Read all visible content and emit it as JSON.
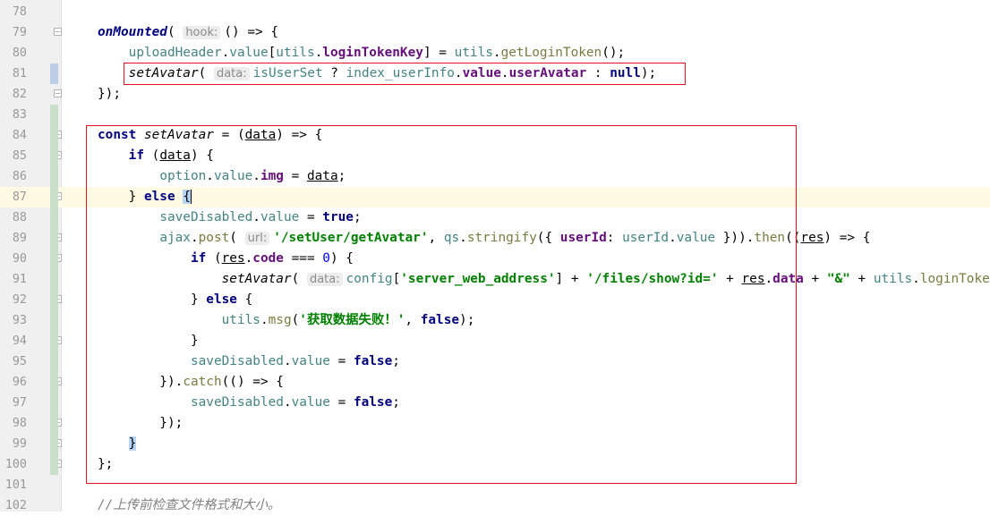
{
  "editor": {
    "lines": [
      {
        "n": "78",
        "html": ""
      },
      {
        "n": "79",
        "html": "<span class=\"fnb\">onMounted</span>( <span class=\"hint\">hook:</span>() => {"
      },
      {
        "n": "80",
        "html": "    <span class=\"ident\">uploadHeader</span>.<span class=\"propn\">value</span>[<span class=\"ident\">utils</span>.<span class=\"prop\">loginTokenKey</span>] = <span class=\"ident\">utils</span>.<span class=\"m\">getLoginToken</span>();"
      },
      {
        "n": "81",
        "html": "    <span class=\"fn\">setAvatar</span>( <span class=\"hint\">data:</span><span class=\"ident\">isUserSet</span> ? <span class=\"ident\">index_userInfo</span>.<span class=\"prop\">value</span>.<span class=\"prop\">userAvatar</span> : <span class=\"kw\">null</span>);"
      },
      {
        "n": "82",
        "html": "});"
      },
      {
        "n": "83",
        "html": ""
      },
      {
        "n": "84",
        "html": "<span class=\"kw\">const</span> <span class=\"fn\">setAvatar</span> = (<span class=\"param\">data</span>) => {"
      },
      {
        "n": "85",
        "html": "    <span class=\"kw\">if</span> (<span class=\"param\">data</span>) {"
      },
      {
        "n": "86",
        "html": "        <span class=\"ident\">option</span>.<span class=\"propn\">value</span>.<span class=\"prop\">img</span> = <span class=\"param\">data</span>;"
      },
      {
        "n": "87",
        "html": "    } <span class=\"kw\">else</span> <span class=\"brace-hl\">{</span><span class=\"caret\"></span>"
      },
      {
        "n": "88",
        "html": "        <span class=\"ident\">saveDisabled</span>.<span class=\"propn\">value</span> = <span class=\"kw\">true</span>;"
      },
      {
        "n": "89",
        "html": "        <span class=\"ident\">ajax</span>.<span class=\"m\">post</span>( <span class=\"hint\">url:</span><span class=\"str\">'/setUser/getAvatar'</span>, <span class=\"ident\">qs</span>.<span class=\"m\">stringify</span>({ <span class=\"prop\">userId</span>: <span class=\"ident\">userId</span>.<span class=\"propn\">value</span> })).<span class=\"m\">then</span>((<span class=\"param\">res</span>) => {"
      },
      {
        "n": "90",
        "html": "            <span class=\"kw\">if</span> (<span class=\"param\">res</span>.<span class=\"prop\">code</span> === <span class=\"num\">0</span>) {"
      },
      {
        "n": "91",
        "html": "                <span class=\"fn\">setAvatar</span>( <span class=\"hint\">data:</span><span class=\"ident\">config</span>[<span class=\"str\">'server_web_address'</span>] + <span class=\"str\">'/files/show?id='</span> + <span class=\"param\">res</span>.<span class=\"prop\">data</span> + <span class=\"str\">\"&\"</span> + <span class=\"ident\">utils</span>.<span class=\"m\">loginToken</span>"
      },
      {
        "n": "92",
        "html": "            } <span class=\"kw\">else</span> {"
      },
      {
        "n": "93",
        "html": "                <span class=\"ident\">utils</span>.<span class=\"m\">msg</span>(<span class=\"str\">'获取数据失败！'</span>, <span class=\"kw\">false</span>);"
      },
      {
        "n": "94",
        "html": "            }"
      },
      {
        "n": "95",
        "html": "            <span class=\"ident\">saveDisabled</span>.<span class=\"propn\">value</span> = <span class=\"kw\">false</span>;"
      },
      {
        "n": "96",
        "html": "        }).<span class=\"m\">catch</span>(() => {"
      },
      {
        "n": "97",
        "html": "            <span class=\"ident\">saveDisabled</span>.<span class=\"propn\">value</span> = <span class=\"kw\">false</span>;"
      },
      {
        "n": "98",
        "html": "        });"
      },
      {
        "n": "99",
        "html": "    <span class=\"brace-hl\">}</span>"
      },
      {
        "n": "100",
        "html": "};"
      },
      {
        "n": "101",
        "html": ""
      },
      {
        "n": "102",
        "html": "<span class=\"cmt\">//上传前检查文件格式和大小。</span>"
      }
    ],
    "current_line": "87",
    "fold_start_lines": [
      "79",
      "84",
      "85",
      "89",
      "90",
      "92",
      "96"
    ],
    "fold_end_lines": [
      "82",
      "87",
      "94",
      "98",
      "99",
      "100"
    ]
  },
  "colors": {
    "highlight_box": "#e0151c",
    "gutter_bg": "#f0f0f0",
    "current_line_bg": "#fffae3",
    "change_marker_green": "#c9dfc9",
    "change_marker_blue": "#bccde8"
  }
}
